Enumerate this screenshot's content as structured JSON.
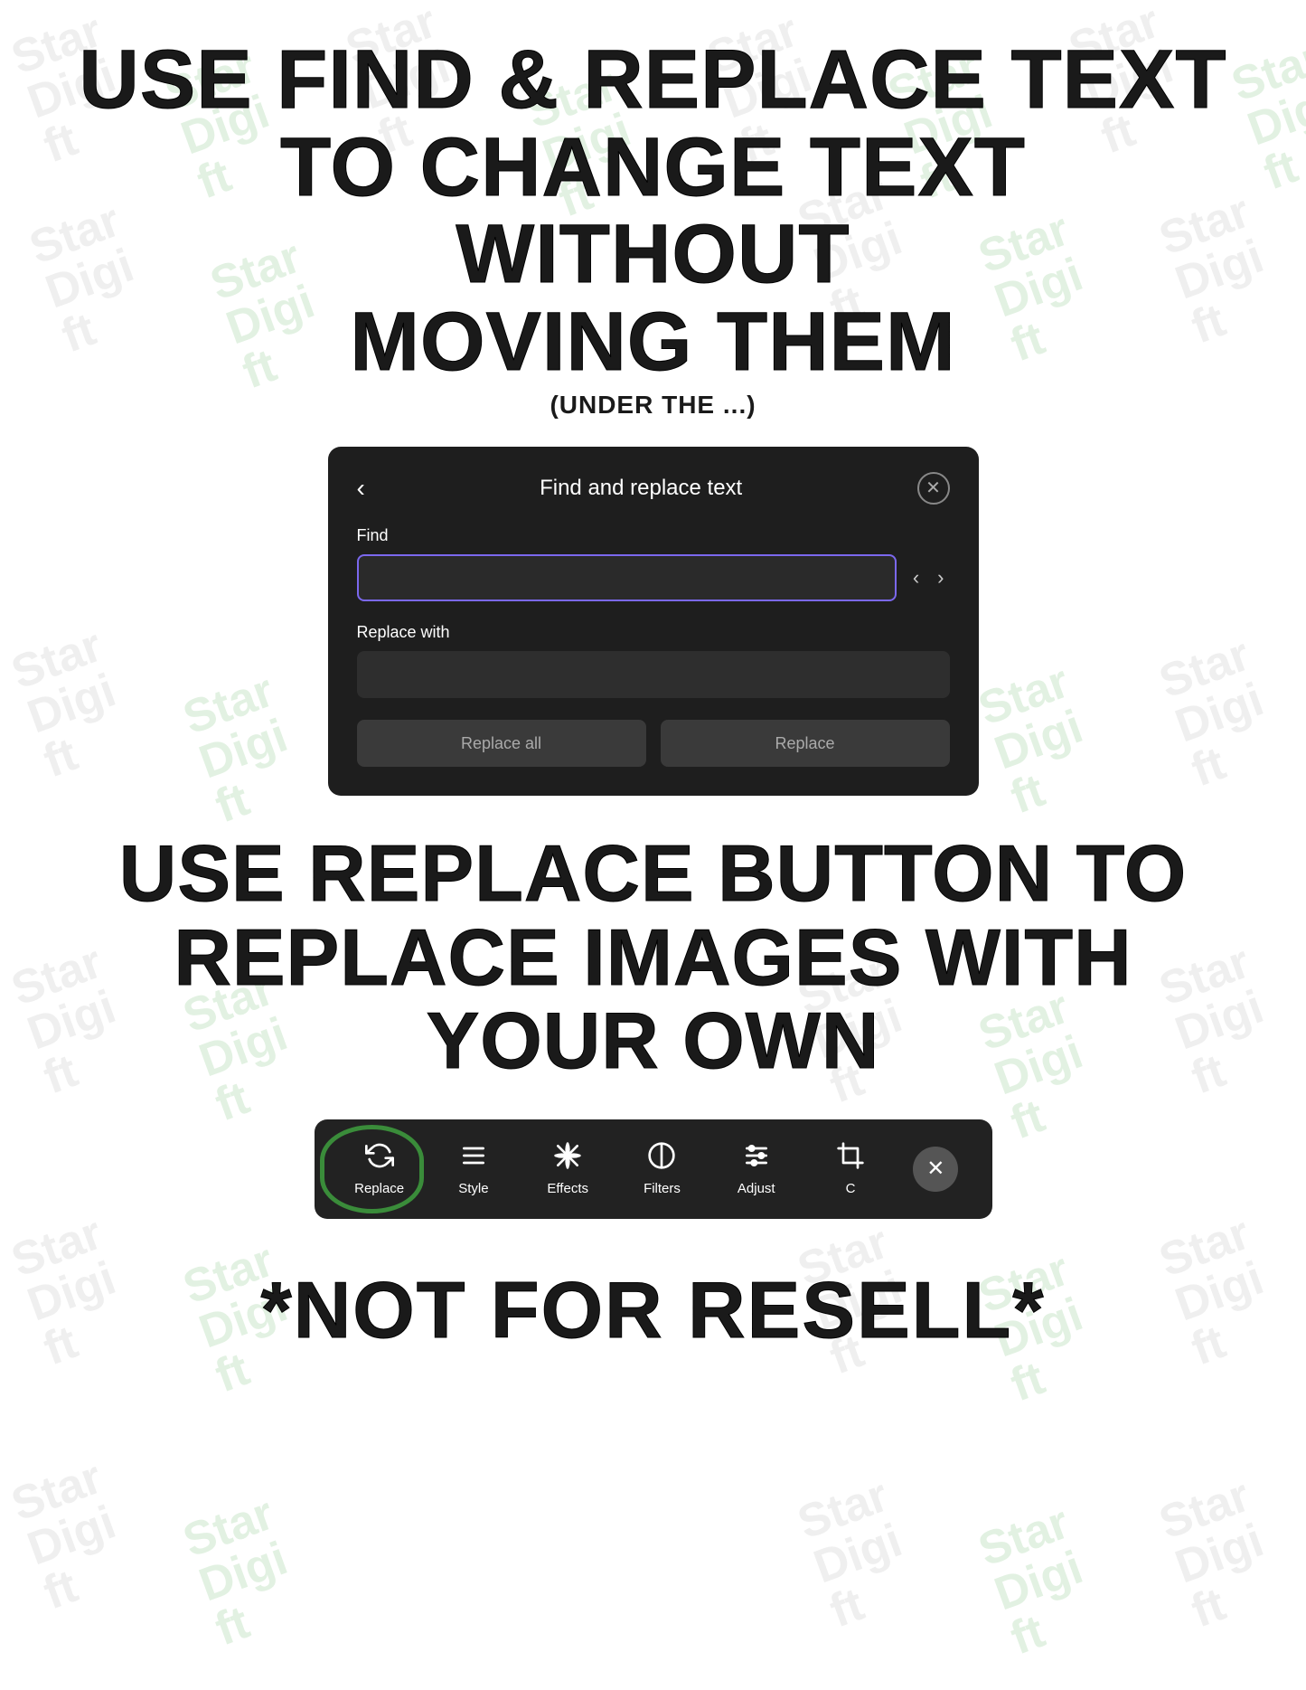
{
  "watermarks": {
    "text_dark": [
      "Star",
      "Digi",
      "ft"
    ],
    "text_green": [
      "Star",
      "Digi",
      "ft"
    ]
  },
  "headline1": {
    "line1": "USE FIND & REPLACE TEXT",
    "line2": "TO CHANGE TEXT WITHOUT",
    "line3": "MOVING THEM"
  },
  "subtitle": "(UNDER THE ...)",
  "dialog": {
    "title": "Find and replace text",
    "back_label": "‹",
    "close_label": "✕",
    "find_label": "Find",
    "find_placeholder": "",
    "replace_label": "Replace with",
    "replace_placeholder": "",
    "btn_replace_all": "Replace all",
    "btn_replace": "Replace",
    "prev_arrow": "‹",
    "next_arrow": "›"
  },
  "headline2": {
    "line1": "USE REPLACE BUTTON TO",
    "line2": "REPLACE IMAGES WITH",
    "line3": "YOUR OWN"
  },
  "toolbar": {
    "items": [
      {
        "id": "replace",
        "label": "Replace",
        "icon": "replace"
      },
      {
        "id": "style",
        "label": "Style",
        "icon": "style"
      },
      {
        "id": "effects",
        "label": "Effects",
        "icon": "effects"
      },
      {
        "id": "filters",
        "label": "Filters",
        "icon": "filters"
      },
      {
        "id": "adjust",
        "label": "Adjust",
        "icon": "adjust"
      },
      {
        "id": "crop",
        "label": "C",
        "icon": "crop"
      }
    ],
    "close_label": "✕"
  },
  "footer": {
    "text": "*NOT FOR RESELL*"
  }
}
